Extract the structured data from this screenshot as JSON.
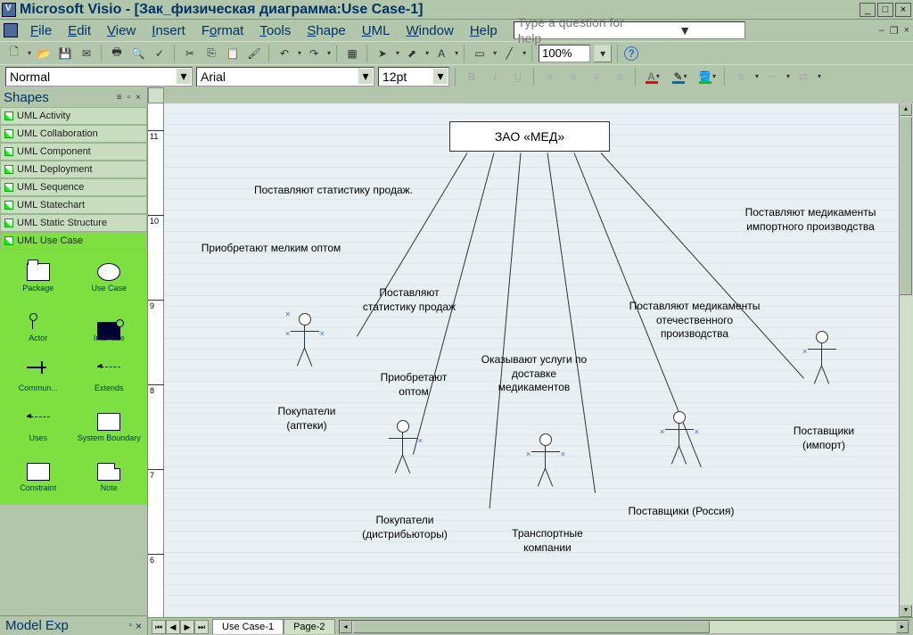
{
  "titlebar": {
    "title": "Microsoft Visio - [Зак_физическая диаграмма:Use Case-1]"
  },
  "menu": {
    "file": "File",
    "edit": "Edit",
    "view": "View",
    "insert": "Insert",
    "format": "Format",
    "tools": "Tools",
    "shape": "Shape",
    "uml": "UML",
    "window": "Window",
    "help": "Help",
    "helpbox": "Type a question for help"
  },
  "toolbar": {
    "zoom": "100%"
  },
  "format_tb": {
    "style": "Normal",
    "font": "Arial",
    "size": "12pt"
  },
  "shapes_panel": {
    "title": "Shapes",
    "stencils": [
      "UML Activity",
      "UML Collaboration",
      "UML Component",
      "UML Deployment",
      "UML Sequence",
      "UML Statechart",
      "UML Static Structure",
      "UML Use Case"
    ],
    "shapes": [
      "Package",
      "Use Case",
      "Actor",
      "Interface",
      "Commun...",
      "Extends",
      "Uses",
      "System Boundary",
      "Constraint",
      "Note"
    ]
  },
  "model_explorer": "Model Exp",
  "diagram": {
    "main_node": "ЗАО «МЕД»",
    "labels": {
      "l1": "Поставляют статистику продаж.",
      "l2": "Приобретают мелким оптом",
      "l3": "Поставляют статистику продаж",
      "l4": "Приобретают оптом",
      "l5": "Оказывают услуги по доставке медикаментов",
      "l6": "Поставляют медикаменты отечественного производства",
      "l7": "Поставляют медикаменты импортного производства"
    },
    "actors": {
      "a1": "Покупатели (аптеки)",
      "a2": "Покупатели (дистрибьюторы)",
      "a3": "Транспортные компании",
      "a4": "Поставщики (Россия)",
      "a5": "Поставщики (импорт)"
    }
  },
  "tabs": {
    "t1": "Use Case-1",
    "t2": "Page-2"
  }
}
